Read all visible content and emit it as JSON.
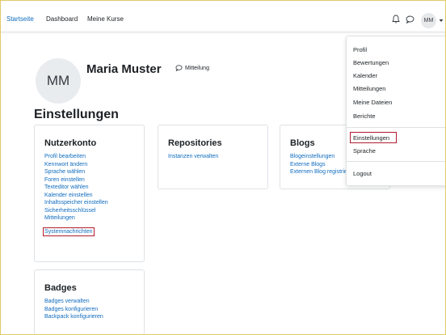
{
  "nav": {
    "links": [
      "Startseite",
      "Dashboard",
      "Meine Kurse"
    ],
    "user_initials": "MM"
  },
  "header": {
    "initials": "MM",
    "user_name": "Maria Muster",
    "message_label": "Mitteilung"
  },
  "page_title": "Einstellungen",
  "cards": {
    "nutzerkonto": {
      "title": "Nutzerkonto",
      "links": [
        "Profil bearbeiten",
        "Kennwort ändern",
        "Sprache wählen",
        "Foren einstellen",
        "Texteditor wählen",
        "Kalender einstellen",
        "Inhaltsspeicher einstellen",
        "Sicherheitsschlüssel",
        "Mitteilungen",
        "Systemnachrichten"
      ]
    },
    "repositories": {
      "title": "Repositories",
      "links": [
        "Instanzen verwalten"
      ]
    },
    "blogs": {
      "title": "Blogs",
      "links": [
        "Blogeinstellungen",
        "Externe Blogs",
        "Externen Blog registrieren"
      ]
    },
    "badges": {
      "title": "Badges",
      "links": [
        "Badges verwalten",
        "Badges konfigurieren",
        "Backpack konfigurieren"
      ]
    }
  },
  "user_menu": {
    "items": [
      "Profil",
      "Bewertungen",
      "Kalender",
      "Mitteilungen",
      "Meine Dateien",
      "Berichte"
    ],
    "settings": "Einstellungen",
    "language": "Sprache",
    "logout": "Logout"
  },
  "colors": {
    "link": "#0f6cbf",
    "highlight": "#b01c2e",
    "frame": "#e3c96a"
  }
}
